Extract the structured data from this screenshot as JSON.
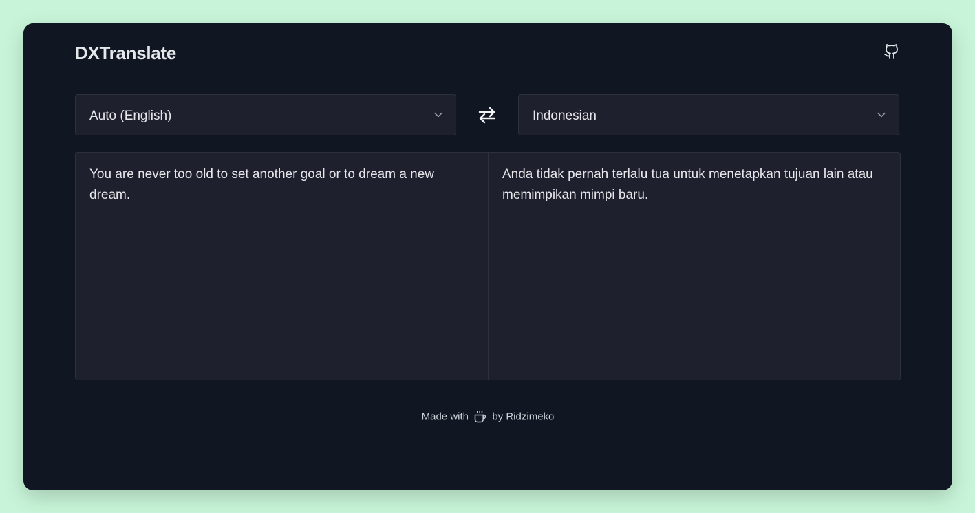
{
  "header": {
    "title": "DXTranslate",
    "github_icon": "github-icon"
  },
  "source": {
    "language": "Auto (English)",
    "text": "You are never too old to set another goal or to dream a new dream."
  },
  "target": {
    "language": "Indonesian",
    "text": "Anda tidak pernah terlalu tua untuk menetapkan tujuan lain atau memimpikan mimpi baru."
  },
  "swap_icon": "swap-arrows-icon",
  "footer": {
    "made_with": "Made with",
    "icon": "coffee-icon",
    "by": "by Ridzimeko"
  },
  "colors": {
    "page_background": "#c8f5d9",
    "window_background": "#111722",
    "panel_background": "#1e212d",
    "text": "#e5e7eb"
  }
}
